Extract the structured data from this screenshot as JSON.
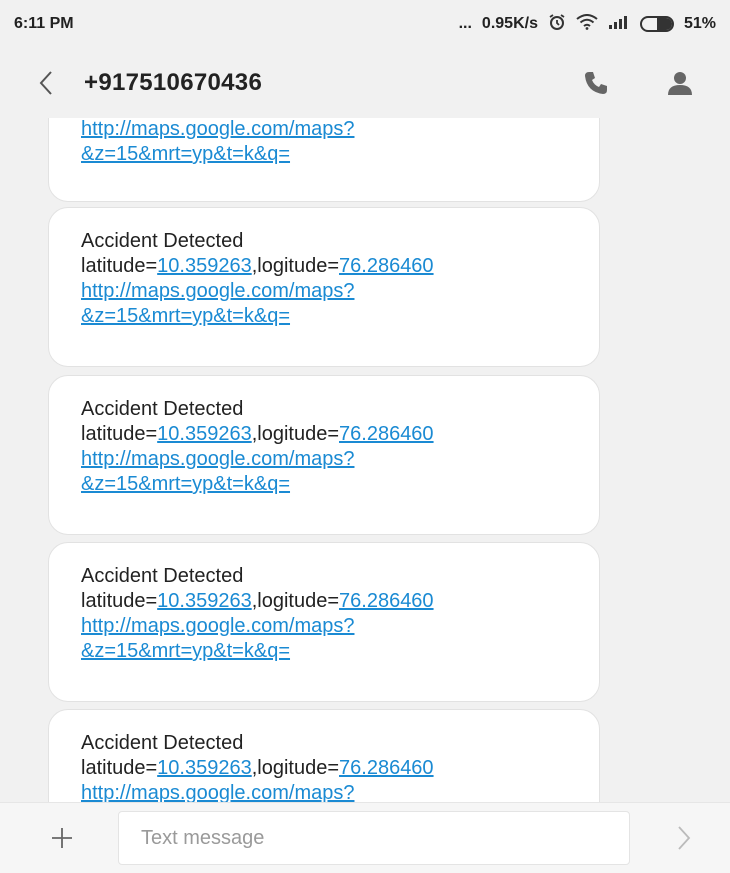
{
  "status": {
    "time": "6:11 PM",
    "dots": "...",
    "speed": "0.95K/s",
    "battery_percent": "51%",
    "battery_level": 0.51
  },
  "header": {
    "title": "+917510670436",
    "icons": [
      "back-chevron-icon",
      "phone-icon",
      "contact-icon"
    ]
  },
  "partial_message": {
    "lines": [
      {
        "text": "http://maps.google.com/maps?",
        "type": "link"
      },
      {
        "text": "&z=15&mrt=yp&t=k&q=",
        "type": "link"
      }
    ]
  },
  "messages": [
    {
      "heading": "Accident Detected",
      "lat_label": "latitude=",
      "lat_value": "10.359263",
      "lon_label": ",logitude=",
      "lon_value": "76.286460",
      "url_line1": "http://maps.google.com/maps?",
      "url_line2": "&z=15&mrt=yp&t=k&q="
    },
    {
      "heading": "Accident Detected",
      "lat_label": "latitude=",
      "lat_value": "10.359263",
      "lon_label": ",logitude=",
      "lon_value": "76.286460",
      "url_line1": "http://maps.google.com/maps?",
      "url_line2": "&z=15&mrt=yp&t=k&q="
    },
    {
      "heading": "Accident Detected",
      "lat_label": "latitude=",
      "lat_value": "10.359263",
      "lon_label": ",logitude=",
      "lon_value": "76.286460",
      "url_line1": "http://maps.google.com/maps?",
      "url_line2": "&z=15&mrt=yp&t=k&q="
    },
    {
      "heading": "Accident Detected",
      "lat_label": "latitude=",
      "lat_value": "10.359263",
      "lon_label": ",logitude=",
      "lon_value": "76.286460",
      "url_line1": "http://maps.google.com/maps?"
    }
  ],
  "compose": {
    "placeholder": "Text message",
    "icons": [
      "plus-icon",
      "send-arrow-icon"
    ]
  },
  "colors": {
    "link": "#1a8ad3",
    "background": "#f1f1f1",
    "bubble": "#ffffff"
  }
}
